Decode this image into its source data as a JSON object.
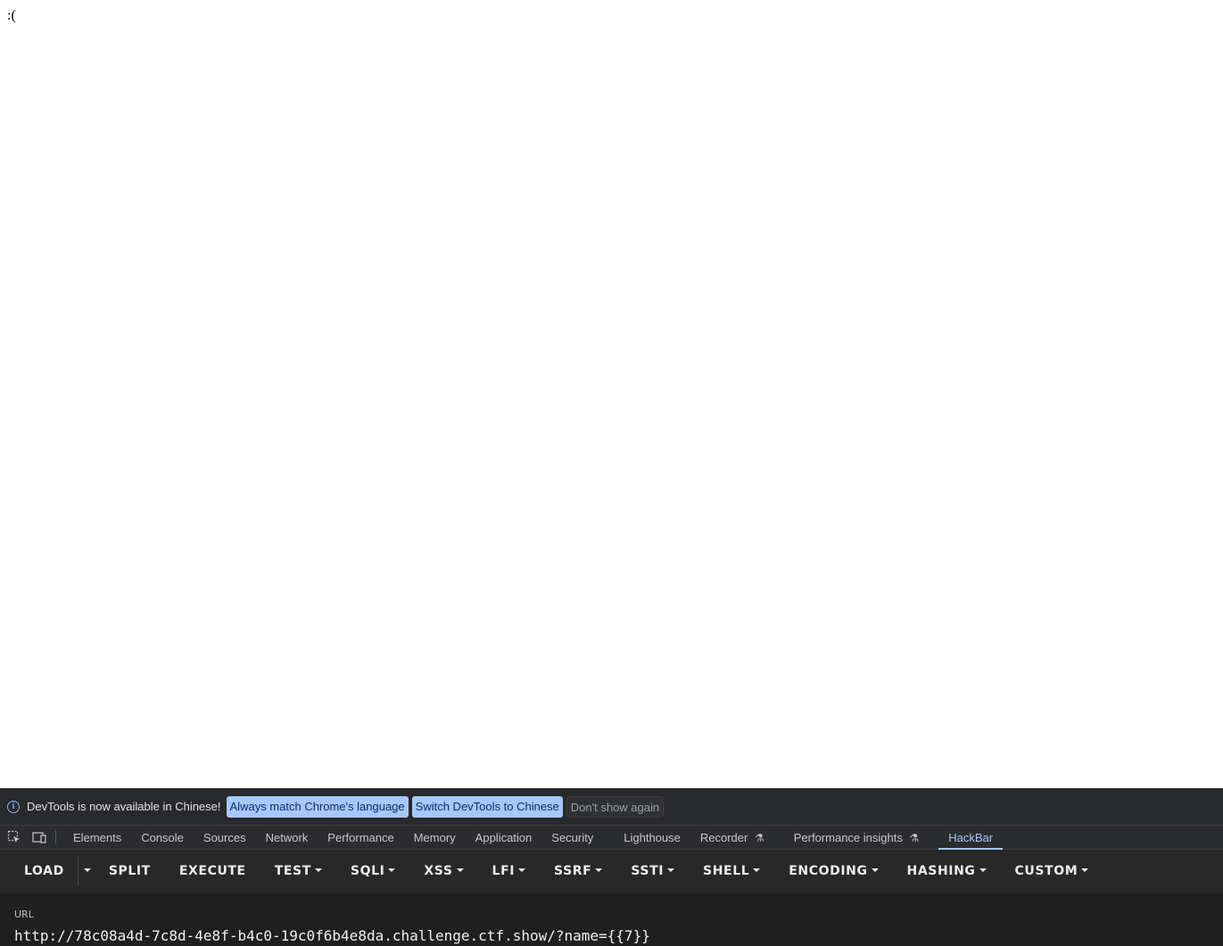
{
  "page": {
    "body_text": ":("
  },
  "devtools": {
    "infobar": {
      "icon": "info-icon",
      "message": "DevTools is now available in Chinese!",
      "always_match_label": "Always match Chrome's language",
      "switch_label": "Switch DevTools to Chinese",
      "dont_show_label": "Don't show again"
    },
    "tabs": [
      {
        "label": "Elements"
      },
      {
        "label": "Console"
      },
      {
        "label": "Sources"
      },
      {
        "label": "Network"
      },
      {
        "label": "Performance"
      },
      {
        "label": "Memory"
      },
      {
        "label": "Application"
      },
      {
        "label": "Security"
      },
      {
        "label": "Lighthouse"
      },
      {
        "label": "Recorder",
        "experimental": true
      },
      {
        "label": "Performance insights",
        "experimental": true
      },
      {
        "label": "HackBar",
        "active": true
      }
    ],
    "toolbar_icons": [
      "inspect-element-icon",
      "device-toolbar-icon"
    ]
  },
  "hackbar": {
    "buttons": {
      "load": "LOAD",
      "split": "SPLIT",
      "execute": "EXECUTE",
      "test": "TEST",
      "sqli": "SQLI",
      "xss": "XSS",
      "lfi": "LFI",
      "ssrf": "SSRF",
      "ssti": "SSTI",
      "shell": "SHELL",
      "encoding": "ENCODING",
      "hashing": "HASHING",
      "custom": "CUSTOM"
    },
    "url_label": "URL",
    "url_value": "http://78c08a4d-7c8d-4e8f-b4c0-19c0f6b4e8da.challenge.ctf.show/?name={{7}}"
  },
  "colors": {
    "accent": "#a8c7fa",
    "devtools_bg": "#202124",
    "hackbar_toolbar_bg": "#282828",
    "hackbar_body_bg": "#1f1f1f"
  }
}
